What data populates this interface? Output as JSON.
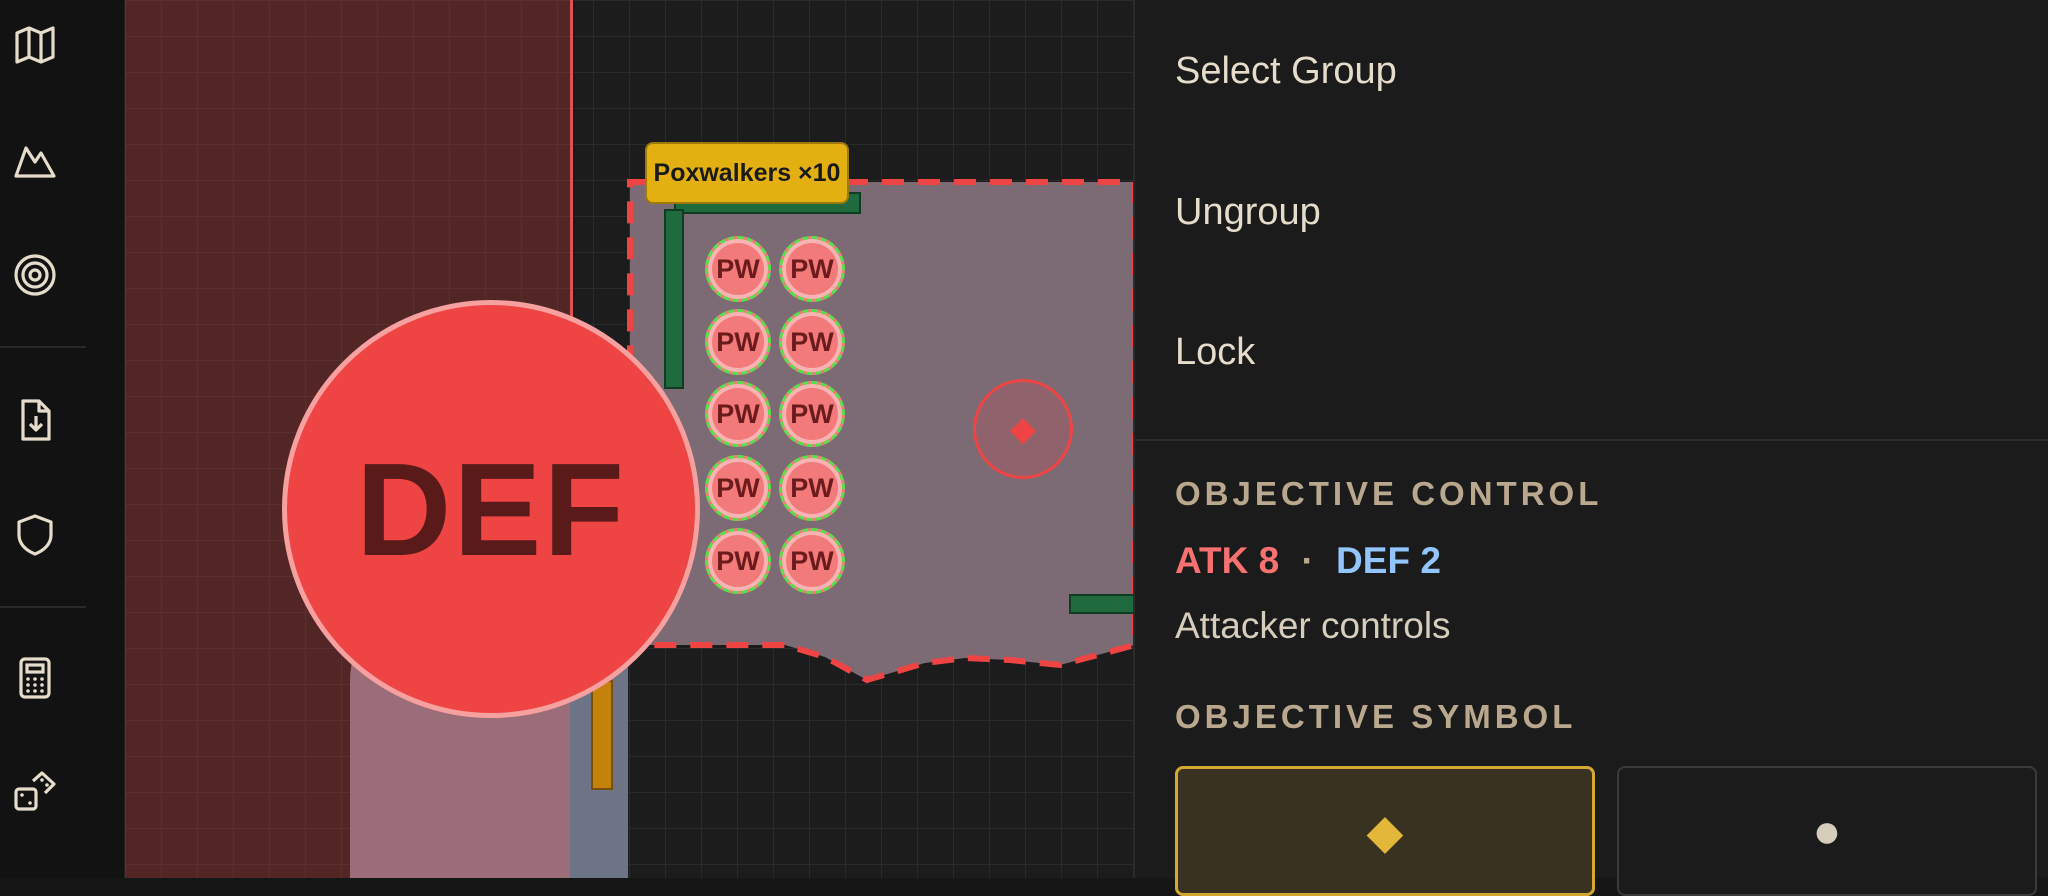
{
  "sidebar": {
    "items": [
      {
        "name": "map-icon"
      },
      {
        "name": "terrain-icon"
      },
      {
        "name": "target-icon"
      },
      {
        "name": "import-file-icon"
      },
      {
        "name": "shield-icon"
      },
      {
        "name": "calculator-icon"
      },
      {
        "name": "dice-icon"
      }
    ]
  },
  "map": {
    "unit_label": "Poxwalkers ×10",
    "token_text": "PW",
    "deploy_marker": "DEF",
    "objective_symbol": "◆"
  },
  "panel": {
    "menu": [
      "Select Group",
      "Ungroup",
      "Lock"
    ],
    "objective_control": {
      "title": "OBJECTIVE CONTROL",
      "atk": "ATK 8",
      "separator": "·",
      "def": "DEF 2",
      "status": "Attacker controls"
    },
    "objective_symbol": {
      "title": "OBJECTIVE SYMBOL",
      "options": [
        {
          "glyph": "◆",
          "selected": true
        },
        {
          "glyph": "●",
          "selected": false
        }
      ]
    }
  },
  "colors": {
    "attacker": "#f87171",
    "defender": "#93c5fd",
    "accent": "#e3b73a",
    "def_marker": "#ef4444"
  }
}
